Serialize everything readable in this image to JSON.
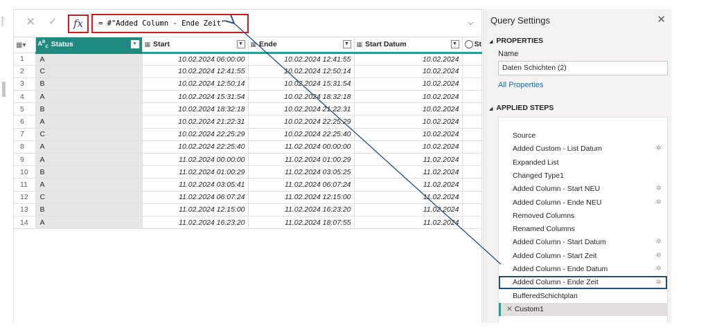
{
  "formula": {
    "fx_label": "fx",
    "value": "= #\"Added Column - Ende Zeit\""
  },
  "grid": {
    "columns": [
      {
        "label": "Status",
        "type_icon": "A B C",
        "type_icon_name": "text-type-icon"
      },
      {
        "label": "Start",
        "type_icon": "◷",
        "type_icon_name": "datetime-type-icon"
      },
      {
        "label": "Ende",
        "type_icon": "◷",
        "type_icon_name": "datetime-type-icon"
      },
      {
        "label": "Start Datum",
        "type_icon": "▦",
        "type_icon_name": "date-type-icon"
      },
      {
        "label": "St",
        "type_icon": "◷",
        "type_icon_name": "time-type-icon"
      }
    ],
    "rows": [
      {
        "n": "1",
        "status": "A",
        "start": "10.02.2024 06:00:00",
        "ende": "10.02.2024 12:41:55",
        "datum": "10.02.2024"
      },
      {
        "n": "2",
        "status": "C",
        "start": "10.02.2024 12:41:55",
        "ende": "10.02.2024 12:50:14",
        "datum": "10.02.2024"
      },
      {
        "n": "3",
        "status": "B",
        "start": "10.02.2024 12:50:14",
        "ende": "10.02.2024 15:31:54",
        "datum": "10.02.2024"
      },
      {
        "n": "4",
        "status": "A",
        "start": "10.02.2024 15:31:54",
        "ende": "10.02.2024 18:32:18",
        "datum": "10.02.2024"
      },
      {
        "n": "5",
        "status": "B",
        "start": "10.02.2024 18:32:18",
        "ende": "10.02.2024 21:22:31",
        "datum": "10.02.2024"
      },
      {
        "n": "6",
        "status": "A",
        "start": "10.02.2024 21:22:31",
        "ende": "10.02.2024 22:25:29",
        "datum": "10.02.2024"
      },
      {
        "n": "7",
        "status": "C",
        "start": "10.02.2024 22:25:29",
        "ende": "10.02.2024 22:25:40",
        "datum": "10.02.2024"
      },
      {
        "n": "8",
        "status": "A",
        "start": "10.02.2024 22:25:40",
        "ende": "11.02.2024 00:00:00",
        "datum": "10.02.2024"
      },
      {
        "n": "9",
        "status": "A",
        "start": "11.02.2024 00:00:00",
        "ende": "11.02.2024 01:00:29",
        "datum": "11.02.2024"
      },
      {
        "n": "10",
        "status": "B",
        "start": "11.02.2024 01:00:29",
        "ende": "11.02.2024 03:05:25",
        "datum": "11.02.2024"
      },
      {
        "n": "11",
        "status": "A",
        "start": "11.02.2024 03:05:41",
        "ende": "11.02.2024 06:07:24",
        "datum": "11.02.2024"
      },
      {
        "n": "12",
        "status": "C",
        "start": "11.02.2024 06:07:24",
        "ende": "11.02.2024 12:15:00",
        "datum": "11.02.2024"
      },
      {
        "n": "13",
        "status": "B",
        "start": "11.02.2024 12:15:00",
        "ende": "11.02.2024 16:23:20",
        "datum": "11.02.2024"
      },
      {
        "n": "14",
        "status": "A",
        "start": "11.02.2024 16:23:20",
        "ende": "11.02.2024 18:07:55",
        "datum": "11.02.2024"
      }
    ]
  },
  "query_settings": {
    "title": "Query Settings",
    "properties_header": "PROPERTIES",
    "name_label": "Name",
    "name_value": "Daten Schichten (2)",
    "all_properties_link": "All Properties",
    "applied_steps_header": "APPLIED STEPS",
    "steps": [
      {
        "label": "Source",
        "gear": false
      },
      {
        "label": "Added Custom - List Datum",
        "gear": true
      },
      {
        "label": "Expanded List",
        "gear": false
      },
      {
        "label": "Changed Type1",
        "gear": false
      },
      {
        "label": "Added Column - Start NEU",
        "gear": true
      },
      {
        "label": "Added Column - Ende NEU",
        "gear": true
      },
      {
        "label": "Removed Columns",
        "gear": false
      },
      {
        "label": "Renamed Columns",
        "gear": false
      },
      {
        "label": "Added Column - Start Datum",
        "gear": true
      },
      {
        "label": "Added Column - Start Zeit",
        "gear": true
      },
      {
        "label": "Added Column - Ende Datum",
        "gear": true
      },
      {
        "label": "Added Column - Ende Zeit",
        "gear": true
      },
      {
        "label": "BufferedSchichtplan",
        "gear": false
      },
      {
        "label": "Custom1",
        "gear": false
      }
    ]
  },
  "colors": {
    "accent_teal": "#11a89a",
    "status_header": "#1f8a80",
    "annotation_red": "#d21a1a",
    "annotation_navy": "#1e4e79"
  }
}
